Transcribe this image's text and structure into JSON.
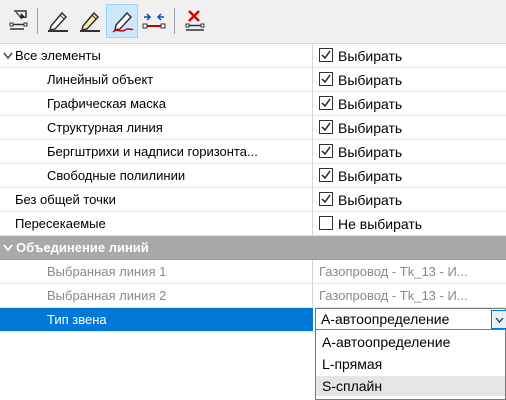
{
  "toolbar": {
    "buttons": [
      {
        "name": "select-objects",
        "icon": "select-objects-icon"
      },
      {
        "name": "pencil",
        "icon": "pencil-icon"
      },
      {
        "name": "pencil-alt",
        "icon": "pencil-alt-icon"
      },
      {
        "name": "pencil-line",
        "icon": "pencil-line-icon",
        "active": true
      },
      {
        "name": "segment-points",
        "icon": "segment-points-icon"
      },
      {
        "name": "delete",
        "icon": "delete-x-icon"
      }
    ]
  },
  "properties": {
    "all_elements": {
      "label": "Все элементы",
      "value": "Выбирать",
      "checked": true
    },
    "children": [
      {
        "label": "Линейный объект",
        "value": "Выбирать",
        "checked": true
      },
      {
        "label": "Графическая маска",
        "value": "Выбирать",
        "checked": true
      },
      {
        "label": "Структурная линия",
        "value": "Выбирать",
        "checked": true
      },
      {
        "label": "Бергштрихи и надписи горизонта...",
        "value": "Выбирать",
        "checked": true
      },
      {
        "label": "Свободные полилинии",
        "value": "Выбирать",
        "checked": true
      }
    ],
    "no_common_point": {
      "label": "Без общей точки",
      "value": "Выбирать",
      "checked": true
    },
    "intersecting": {
      "label": "Пересекаемые",
      "value": "Не выбирать",
      "checked": false
    },
    "merge_group": {
      "title": "Объединение линий"
    },
    "line1": {
      "label": "Выбранная линия 1",
      "value": "Газопровод - Tk_13 - И..."
    },
    "line2": {
      "label": "Выбранная линия 2",
      "value": "Газопровод - Tk_13 - И..."
    },
    "link_type": {
      "label": "Тип звена",
      "value": "А-автоопределение"
    }
  },
  "dropdown": {
    "options": [
      "А-автоопределение",
      "L-прямая",
      "S-сплайн"
    ],
    "highlighted": "S-сплайн"
  },
  "colors": {
    "selection": "#0078d7",
    "group_header": "#a9a9a9",
    "accent": "#cce8ff"
  }
}
